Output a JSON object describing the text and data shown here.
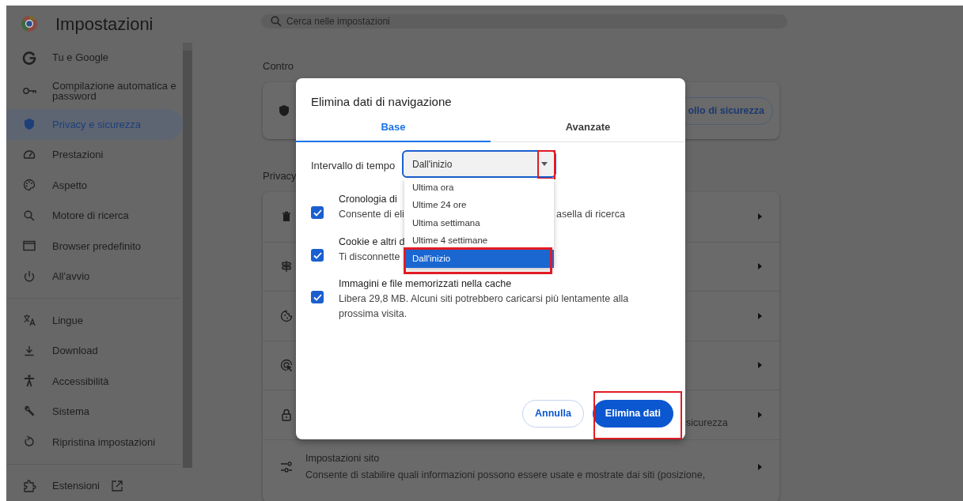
{
  "header": {
    "title": "Impostazioni"
  },
  "search": {
    "placeholder": "Cerca nelle impostazioni"
  },
  "sidebar": {
    "groups": [
      [
        {
          "kind": "google",
          "label": "Tu e Google",
          "selected": false
        },
        {
          "kind": "key",
          "label": "Compilazione automatica e password",
          "selected": false
        },
        {
          "kind": "shield",
          "label": "Privacy e sicurezza",
          "selected": true
        },
        {
          "kind": "gauge",
          "label": "Prestazioni",
          "selected": false
        },
        {
          "kind": "palette",
          "label": "Aspetto",
          "selected": false
        },
        {
          "kind": "search",
          "label": "Motore di ricerca",
          "selected": false
        },
        {
          "kind": "window",
          "label": "Browser predefinito",
          "selected": false
        },
        {
          "kind": "power",
          "label": "All'avvio",
          "selected": false
        }
      ],
      [
        {
          "kind": "translate",
          "label": "Lingue",
          "selected": false
        },
        {
          "kind": "download",
          "label": "Download",
          "selected": false
        },
        {
          "kind": "person",
          "label": "Accessibilità",
          "selected": false
        },
        {
          "kind": "wrench",
          "label": "Sistema",
          "selected": false
        },
        {
          "kind": "reset",
          "label": "Ripristina impostazioni",
          "selected": false
        }
      ],
      [
        {
          "kind": "puzzle",
          "label": "Estensioni",
          "selected": false,
          "external": true
        }
      ]
    ]
  },
  "safety": {
    "heading": "Contro",
    "button": "ollo di sicurezza"
  },
  "privacy": {
    "heading": "Privacy",
    "rows": [
      {
        "kind": "trash"
      },
      {
        "kind": "signpost"
      },
      {
        "kind": "cookie"
      },
      {
        "kind": "target"
      },
      {
        "kind": "lock",
        "fragment": "sicurezza"
      },
      {
        "kind": "sliders",
        "title": "Impostazioni sito",
        "description": "Consente di stabilire quali informazioni possono essere usate e mostrate dai siti (posizione,"
      }
    ]
  },
  "dialog": {
    "title": "Elimina dati di navigazione",
    "tabs": [
      {
        "label": "Base",
        "selected": true
      },
      {
        "label": "Avanzate",
        "selected": false
      }
    ],
    "time_range": {
      "label": "Intervallo di tempo",
      "value": "Dall'inizio"
    },
    "options": [
      {
        "label": "Ultima ora",
        "selected": false
      },
      {
        "label": "Ultime 24 ore",
        "selected": false
      },
      {
        "label": "Ultima settimana",
        "selected": false
      },
      {
        "label": "Ultime 4 settimane",
        "selected": false
      },
      {
        "label": "Dall'inizio",
        "selected": true
      }
    ],
    "items": [
      {
        "checked": true,
        "title": "Cronologia di",
        "description": "Consente di eli",
        "description_after": "asella di ricerca"
      },
      {
        "checked": true,
        "title": "Cookie e altri d",
        "description": "Ti disconnette"
      },
      {
        "checked": true,
        "title": "Immagini e file memorizzati nella cache",
        "description": "Libera 29,8 MB. Alcuni siti potrebbero caricarsi più lentamente alla prossima visita."
      }
    ],
    "buttons": [
      {
        "kind": "secondary",
        "label": "Annulla"
      },
      {
        "kind": "primary",
        "label": "Elimina dati"
      }
    ]
  }
}
